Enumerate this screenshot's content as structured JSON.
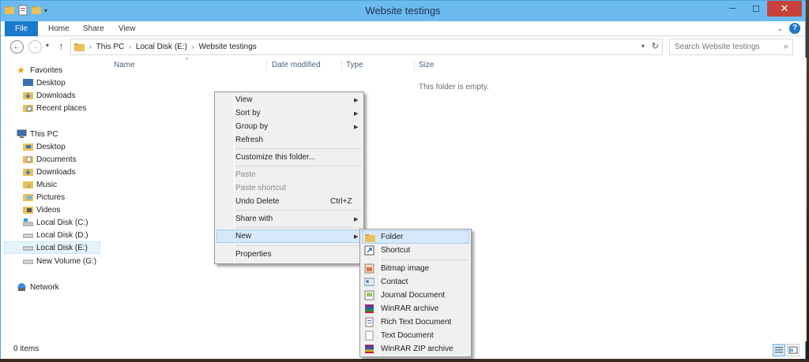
{
  "window": {
    "title": "Website testings"
  },
  "ribbon": {
    "file_label": "File",
    "tabs": [
      "Home",
      "Share",
      "View"
    ]
  },
  "address": {
    "crumbs": [
      "This PC",
      "Local Disk (E:)",
      "Website testings"
    ]
  },
  "search": {
    "placeholder": "Search Website testings"
  },
  "nav": {
    "favorites_label": "Favorites",
    "favorites": [
      "Desktop",
      "Downloads",
      "Recent places"
    ],
    "thispc_label": "This PC",
    "thispc": [
      "Desktop",
      "Documents",
      "Downloads",
      "Music",
      "Pictures",
      "Videos",
      "Local Disk (C:)",
      "Local Disk (D:)",
      "Local Disk (E:)",
      "New Volume (G:)"
    ],
    "network_label": "Network"
  },
  "columns": {
    "name": "Name",
    "date_modified": "Date modified",
    "type": "Type",
    "size": "Size"
  },
  "content": {
    "empty_message": "This folder is empty."
  },
  "status": {
    "items": "0 items"
  },
  "context_menu": {
    "view": "View",
    "sort_by": "Sort by",
    "group_by": "Group by",
    "refresh": "Refresh",
    "customize": "Customize this folder...",
    "paste": "Paste",
    "paste_shortcut": "Paste shortcut",
    "undo_delete": "Undo Delete",
    "undo_shortcut": "Ctrl+Z",
    "share_with": "Share with",
    "new": "New",
    "properties": "Properties"
  },
  "new_submenu": {
    "folder": "Folder",
    "shortcut": "Shortcut",
    "bitmap": "Bitmap image",
    "contact": "Contact",
    "journal": "Journal Document",
    "winrar": "WinRAR archive",
    "rtf": "Rich Text Document",
    "text": "Text Document",
    "winrar_zip": "WinRAR ZIP archive"
  },
  "colors": {
    "accent": "#1979ca",
    "titlebar": "#6cbaf0",
    "close": "#c7433a",
    "highlight": "#d7e8fa"
  }
}
